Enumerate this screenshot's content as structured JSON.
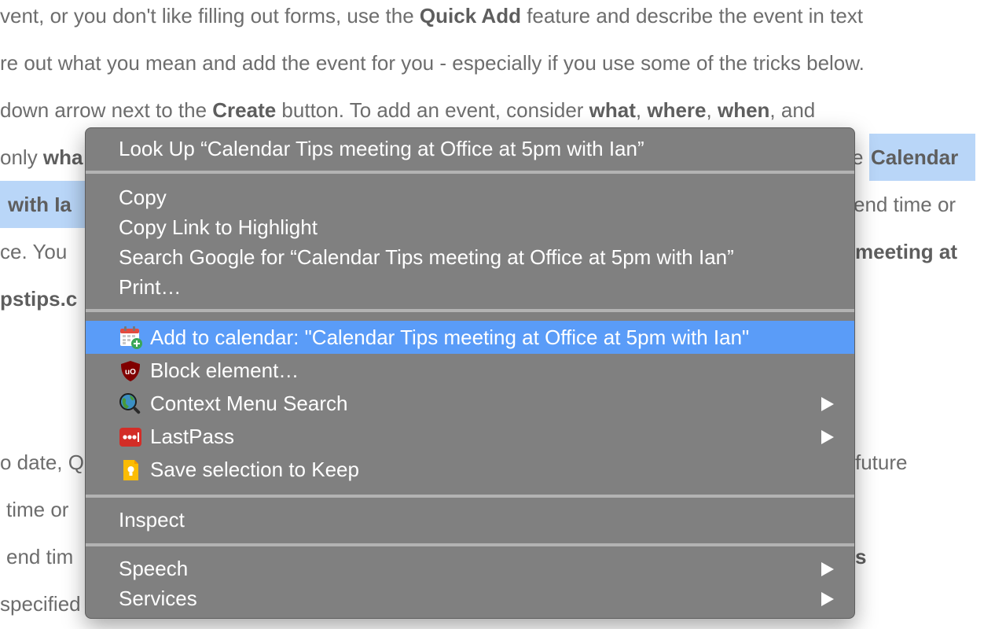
{
  "background_text": {
    "line1": {
      "t1": "vent, or you don't like filling out forms, use the ",
      "b1": "Quick Add",
      "t2": " feature and describe the event in text"
    },
    "line2": {
      "t1": "re out what you mean and add the event for you - especially if you use some of the tricks below."
    },
    "line3": {
      "t1": "down arrow next to the ",
      "b1": "Create",
      "t2": " button. To add an event, consider ",
      "b2": "what",
      "t3": ", ",
      "b3": "where",
      "t4": ", ",
      "b4": "when",
      "t5": ", and"
    },
    "line4_left": {
      "t1": "only ",
      "b1": "wha"
    },
    "line4_right": {
      "t1": "e "
    },
    "highlight_right": "Calendar",
    "highlight_left": "with Ia",
    "line5_right": "end time or",
    "line6_left": "ce. You",
    "line6_right": "meeting at",
    "line7_left": "pstips.c",
    "line8_left": "o date, Q",
    "line8_right": "future",
    "line9_left": "time or",
    "line10_left": "end tim",
    "line10_right": "s",
    "line11_left": "specified"
  },
  "context_menu": {
    "lookup": "Look Up “Calendar Tips meeting at Office at 5pm with Ian”",
    "copy": "Copy",
    "copy_link": "Copy Link to Highlight",
    "search_google": "Search Google for “Calendar Tips meeting at Office at 5pm with Ian”",
    "print": "Print…",
    "add_calendar": "Add to calendar: \"Calendar Tips meeting at Office at 5pm with Ian\"",
    "block_element": "Block element…",
    "context_search": "Context Menu Search",
    "lastpass": "LastPass",
    "save_keep": "Save selection to Keep",
    "inspect": "Inspect",
    "speech": "Speech",
    "services": "Services"
  },
  "icons": {
    "add_calendar": "calendar-plus-icon",
    "block_element": "ublock-shield-icon",
    "context_search": "globe-magnifier-icon",
    "lastpass": "lastpass-icon",
    "save_keep": "google-keep-icon"
  },
  "colors": {
    "menu_bg": "#808080",
    "menu_highlight": "#5a9cf8",
    "text_selection": "#b9d6f8",
    "separator": "#b3b3b3"
  }
}
